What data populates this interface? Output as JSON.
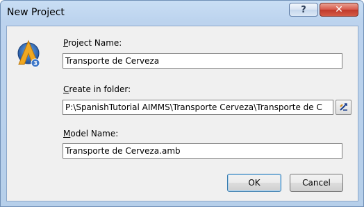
{
  "window": {
    "title": "New Project",
    "help_glyph": "?",
    "close_glyph": "✕"
  },
  "icon": {
    "name": "aimms-logo-icon",
    "badge": "3"
  },
  "project_name": {
    "label_prefix": "P",
    "label_rest": "roject Name:",
    "value": "Transporte de Cerveza"
  },
  "create_in_folder": {
    "label_prefix": "C",
    "label_rest": "reate in folder:",
    "value": "P:\\SpanishTutorial AIMMS\\Transporte Cerveza\\Transporte de C"
  },
  "model_name": {
    "label_prefix": "M",
    "label_rest": "odel Name:",
    "value": "Transporte de Cerveza.amb"
  },
  "buttons": {
    "ok": "OK",
    "cancel": "Cancel"
  },
  "colors": {
    "titlebar": "#bcd3ee",
    "client_bg": "#f0f0f0",
    "close_red": "#c0392b",
    "default_border": "#3c7fb1"
  }
}
